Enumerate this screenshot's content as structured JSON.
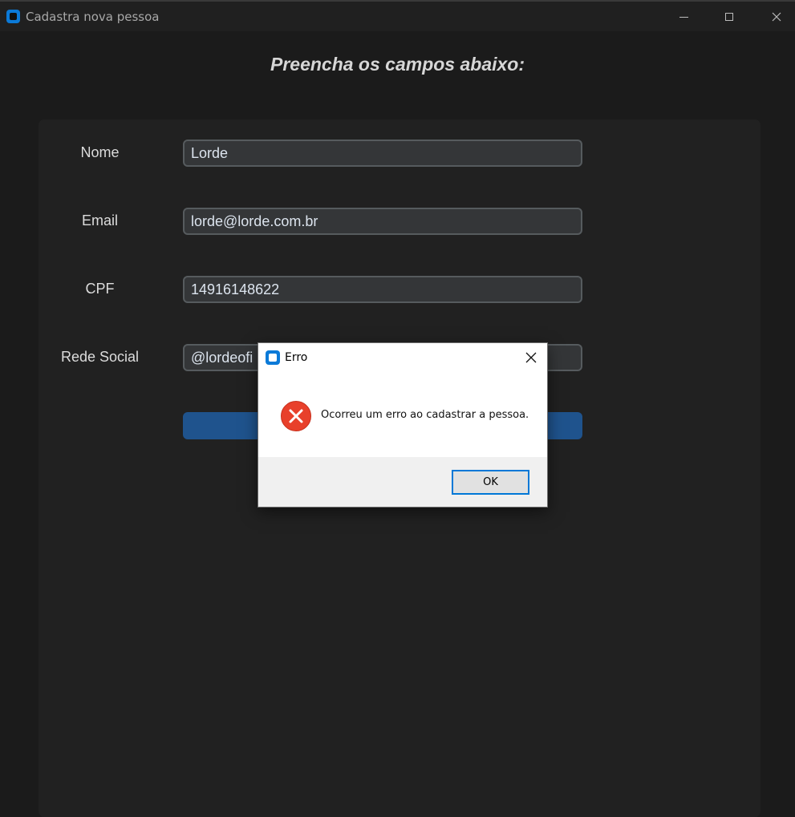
{
  "window": {
    "title": "Cadastra nova pessoa"
  },
  "form": {
    "heading": "Preencha os campos abaixo:",
    "fields": [
      {
        "label": "Nome",
        "value": "Lorde"
      },
      {
        "label": "Email",
        "value": "lorde@lorde.com.br"
      },
      {
        "label": "CPF",
        "value": "14916148622"
      },
      {
        "label": "Rede Social",
        "value": "@lordeofi"
      }
    ]
  },
  "dialog": {
    "title": "Erro",
    "message": "Ocorreu um erro ao cadastrar a pessoa.",
    "ok_label": "OK"
  },
  "colors": {
    "accent_button": "#1f538d",
    "error_red": "#e8402b",
    "focus_blue": "#0078d7"
  },
  "icons": {
    "app": "app-icon",
    "error": "error-x-circle-icon",
    "close": "close-icon"
  }
}
